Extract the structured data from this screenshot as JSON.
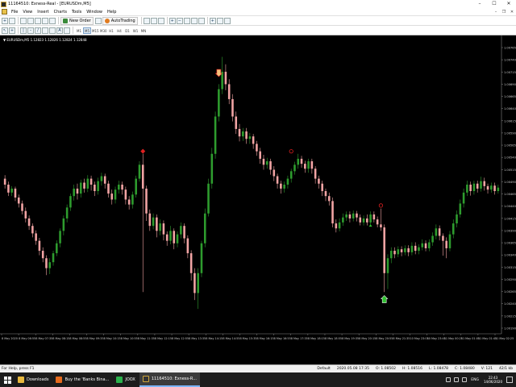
{
  "window": {
    "title": "11164510: Exness-Real - [EURUSDm,M5]",
    "min_label": "–",
    "max_label": "☐",
    "close_label": "✕"
  },
  "menu": {
    "items": [
      "File",
      "View",
      "Insert",
      "Charts",
      "Tools",
      "Window",
      "Help"
    ],
    "mdi_min": "–",
    "mdi_restore": "❐",
    "mdi_close": "✕"
  },
  "toolbar": {
    "new_order_label": "New Order",
    "autotrading_label": "AutoTrading"
  },
  "timeframes": [
    "M1",
    "M5",
    "M15",
    "M30",
    "H1",
    "H4",
    "D1",
    "W1",
    "MN"
  ],
  "active_timeframe": "M5",
  "chart": {
    "symbol_line": "▼ EURUSDm,M5  1.12823  1.12826  1.12824  1.12848",
    "colors": {
      "bull": "#2e9c2e",
      "bear": "#f2a4a4",
      "background": "#000000",
      "axis_text": "#cccccc"
    }
  },
  "chart_data": {
    "type": "candlestick",
    "symbol": "EURUSDm",
    "timeframe": "M5",
    "price_labels": [
      "1.00765",
      "1.00740",
      "1.00715",
      "1.00690",
      "1.00665",
      "1.00640",
      "1.00615",
      "1.00590",
      "1.00565",
      "1.00540",
      "1.00515",
      "1.00490",
      "1.00465",
      "1.00440",
      "1.00415",
      "1.00390",
      "1.00365",
      "1.00340",
      "1.00315",
      "1.00290",
      "1.00265",
      "1.00240",
      "1.00215",
      "1.00190"
    ],
    "time_labels": [
      "8 May 2020",
      "8 May 06:55",
      "8 May 07:35",
      "8 May 08:15",
      "8 May 08:55",
      "8 May 09:35",
      "8 May 10:15",
      "8 May 10:55",
      "8 May 11:35",
      "8 May 12:15",
      "8 May 12:55",
      "8 May 13:35",
      "8 May 14:15",
      "8 May 14:55",
      "8 May 15:35",
      "8 May 16:15",
      "8 May 16:55",
      "8 May 17:35",
      "8 May 18:15",
      "8 May 18:55",
      "8 May 19:35",
      "8 May 20:15",
      "8 May 20:55",
      "8 May 21:35",
      "10 May 23:05",
      "10 May 23:45",
      "11 May 00:25",
      "11 May 01:05",
      "11 May 01:45",
      "11 May 02:25"
    ],
    "candles": [
      [
        1.0049,
        1.00478,
        1.00497,
        1.0047
      ],
      [
        1.00478,
        1.00462,
        1.00484,
        1.00455
      ],
      [
        1.00462,
        1.0047,
        1.00475,
        1.00455
      ],
      [
        1.0047,
        1.00452,
        1.00474,
        1.00445
      ],
      [
        1.00452,
        1.0044,
        1.00458,
        1.00432
      ],
      [
        1.0044,
        1.00425,
        1.00446,
        1.00418
      ],
      [
        1.00425,
        1.0041,
        1.00432,
        1.00402
      ],
      [
        1.0041,
        1.00395,
        1.00416,
        1.00387
      ],
      [
        1.00395,
        1.0038,
        1.004,
        1.00372
      ],
      [
        1.0038,
        1.00365,
        1.00386,
        1.00357
      ],
      [
        1.00365,
        1.00345,
        1.00371,
        1.00336
      ],
      [
        1.00345,
        1.0033,
        1.00352,
        1.00322
      ],
      [
        1.0033,
        1.0031,
        1.00336,
        1.00296
      ],
      [
        1.0031,
        1.00322,
        1.0033,
        1.00298
      ],
      [
        1.00322,
        1.0034,
        1.00345,
        1.00315
      ],
      [
        1.0034,
        1.0036,
        1.00366,
        1.00334
      ],
      [
        1.0036,
        1.00385,
        1.0039,
        1.00352
      ],
      [
        1.00385,
        1.0041,
        1.00416,
        1.00376
      ],
      [
        1.0041,
        1.00432,
        1.00438,
        1.00402
      ],
      [
        1.00432,
        1.00455,
        1.0046,
        1.00425
      ],
      [
        1.00455,
        1.0047,
        1.00478,
        1.00446
      ],
      [
        1.0047,
        1.0046,
        1.0048,
        1.00448
      ],
      [
        1.0046,
        1.00482,
        1.00488,
        1.00452
      ],
      [
        1.00482,
        1.0047,
        1.0049,
        1.00462
      ],
      [
        1.0047,
        1.0049,
        1.00497,
        1.00463
      ],
      [
        1.0049,
        1.00478,
        1.00496,
        1.00466
      ],
      [
        1.00478,
        1.00465,
        1.00484,
        1.00455
      ],
      [
        1.00465,
        1.00485,
        1.00492,
        1.00458
      ],
      [
        1.00485,
        1.00495,
        1.00502,
        1.00476
      ],
      [
        1.00495,
        1.0048,
        1.005,
        1.0047
      ],
      [
        1.0048,
        1.0046,
        1.00486,
        1.00452
      ],
      [
        1.0046,
        1.00448,
        1.00468,
        1.00438
      ],
      [
        1.00448,
        1.00468,
        1.00474,
        1.0044
      ],
      [
        1.00468,
        1.00478,
        1.00486,
        1.0046
      ],
      [
        1.00478,
        1.00468,
        1.00484,
        1.00458
      ],
      [
        1.00468,
        1.00448,
        1.00474,
        1.00438
      ],
      [
        1.00448,
        1.00438,
        1.00455,
        1.00428
      ],
      [
        1.00438,
        1.00458,
        1.00464,
        1.0043
      ],
      [
        1.00458,
        1.0049,
        1.00496,
        1.00452
      ],
      [
        1.0049,
        1.00518,
        1.00525,
        1.00484
      ],
      [
        1.00518,
        1.0047,
        1.0054,
        1.00262
      ],
      [
        1.0047,
        1.0042,
        1.00476,
        1.00405
      ],
      [
        1.0042,
        1.00395,
        1.00428,
        1.00385
      ],
      [
        1.00395,
        1.00412,
        1.0042,
        1.00388
      ],
      [
        1.00412,
        1.00385,
        1.00418,
        1.00372
      ],
      [
        1.00385,
        1.004,
        1.00408,
        1.00376
      ],
      [
        1.004,
        1.00378,
        1.00406,
        1.00366
      ],
      [
        1.00378,
        1.00365,
        1.00384,
        1.00355
      ],
      [
        1.00365,
        1.00385,
        1.00395,
        1.00358
      ],
      [
        1.00385,
        1.0036,
        1.0039,
        1.00348
      ],
      [
        1.0036,
        1.00378,
        1.00384,
        1.00352
      ],
      [
        1.00378,
        1.00395,
        1.00402,
        1.0037
      ],
      [
        1.00395,
        1.0037,
        1.004,
        1.0036
      ],
      [
        1.0037,
        1.0034,
        1.00376,
        1.0033
      ],
      [
        1.0034,
        1.003,
        1.00346,
        1.00285
      ],
      [
        1.003,
        1.0026,
        1.0031,
        1.00246
      ],
      [
        1.0026,
        1.003,
        1.0031,
        1.00228
      ],
      [
        1.003,
        1.0036,
        1.00365,
        1.00292
      ],
      [
        1.0036,
        1.0042,
        1.0043,
        1.00352
      ],
      [
        1.0042,
        1.0048,
        1.0049,
        1.00414
      ],
      [
        1.0048,
        1.0054,
        1.00552,
        1.0047
      ],
      [
        1.0054,
        1.00615,
        1.00625,
        1.0053
      ],
      [
        1.00615,
        1.0067,
        1.0068,
        1.00605
      ],
      [
        1.0067,
        1.00705,
        1.00735,
        1.0066
      ],
      [
        1.00705,
        1.0068,
        1.0072,
        1.00668
      ],
      [
        1.0068,
        1.0065,
        1.0069,
        1.0064
      ],
      [
        1.0065,
        1.00615,
        1.0066,
        1.00605
      ],
      [
        1.00615,
        1.0059,
        1.00625,
        1.0058
      ],
      [
        1.0059,
        1.00575,
        1.006,
        1.00565
      ],
      [
        1.00575,
        1.00585,
        1.00592,
        1.00566
      ],
      [
        1.00585,
        1.0057,
        1.00592,
        1.0056
      ],
      [
        1.0057,
        1.00575,
        1.00582,
        1.0056
      ],
      [
        1.00575,
        1.0056,
        1.0058,
        1.0055
      ],
      [
        1.0056,
        1.00545,
        1.00566,
        1.00536
      ],
      [
        1.00545,
        1.0053,
        1.00552,
        1.0052
      ],
      [
        1.0053,
        1.00518,
        1.00538,
        1.00508
      ],
      [
        1.00518,
        1.00525,
        1.00532,
        1.0051
      ],
      [
        1.00525,
        1.00508,
        1.0053,
        1.00498
      ],
      [
        1.00508,
        1.00495,
        1.00515,
        1.00485
      ],
      [
        1.00495,
        1.0048,
        1.005,
        1.0047
      ],
      [
        1.0048,
        1.0047,
        1.00486,
        1.0046
      ],
      [
        1.0047,
        1.00478,
        1.00484,
        1.00462
      ],
      [
        1.00478,
        1.0049,
        1.00496,
        1.0047
      ],
      [
        1.0049,
        1.00505,
        1.0051,
        1.00482
      ],
      [
        1.00505,
        1.00518,
        1.00524,
        1.00498
      ],
      [
        1.00518,
        1.0053,
        1.0054,
        1.0051
      ],
      [
        1.0053,
        1.0052,
        1.00536,
        1.00512
      ],
      [
        1.0052,
        1.0051,
        1.00526,
        1.00502
      ],
      [
        1.0051,
        1.00525,
        1.0053,
        1.00502
      ],
      [
        1.00525,
        1.0051,
        1.0053,
        1.005
      ],
      [
        1.0051,
        1.0049,
        1.00515,
        1.0048
      ],
      [
        1.0049,
        1.0048,
        1.00496,
        1.0047
      ],
      [
        1.0048,
        1.00465,
        1.00486,
        1.00455
      ],
      [
        1.00465,
        1.00455,
        1.0047,
        1.00445
      ],
      [
        1.00455,
        1.00445,
        1.00462,
        1.00436
      ],
      [
        1.00445,
        1.004,
        1.00452,
        1.00392
      ],
      [
        1.004,
        1.0039,
        1.00408,
        1.00382
      ],
      [
        1.0039,
        1.00402,
        1.0041,
        1.00384
      ],
      [
        1.00402,
        1.00412,
        1.0042,
        1.00395
      ],
      [
        1.00412,
        1.00418,
        1.00424,
        1.00405
      ],
      [
        1.00418,
        1.0041,
        1.00424,
        1.00402
      ],
      [
        1.0041,
        1.0042,
        1.00426,
        1.00404
      ],
      [
        1.0042,
        1.00412,
        1.00425,
        1.00404
      ],
      [
        1.00412,
        1.00402,
        1.00418,
        1.00396
      ],
      [
        1.00402,
        1.0041,
        1.00416,
        1.00396
      ],
      [
        1.0041,
        1.00402,
        1.00418,
        1.00396
      ],
      [
        1.00402,
        1.00418,
        1.00424,
        1.00398
      ],
      [
        1.00418,
        1.00408,
        1.00424,
        1.00402
      ],
      [
        1.00408,
        1.00398,
        1.00414,
        1.00392
      ],
      [
        1.00398,
        1.00392,
        1.0043,
        1.00385
      ],
      [
        1.00392,
        1.003,
        1.00398,
        1.00262
      ],
      [
        1.003,
        1.0033,
        1.00338,
        1.00268
      ],
      [
        1.0033,
        1.00345,
        1.00352,
        1.0032
      ],
      [
        1.00345,
        1.00338,
        1.00352,
        1.0033
      ],
      [
        1.00338,
        1.00348,
        1.00354,
        1.00332
      ],
      [
        1.00348,
        1.00342,
        1.00354,
        1.00334
      ],
      [
        1.00342,
        1.0035,
        1.00356,
        1.00336
      ],
      [
        1.0035,
        1.00342,
        1.00356,
        1.00334
      ],
      [
        1.00342,
        1.00355,
        1.00362,
        1.00336
      ],
      [
        1.00355,
        1.00345,
        1.00362,
        1.00338
      ],
      [
        1.00345,
        1.00352,
        1.00358,
        1.00338
      ],
      [
        1.00352,
        1.0036,
        1.00368,
        1.00346
      ],
      [
        1.0036,
        1.0035,
        1.00366,
        1.00344
      ],
      [
        1.0035,
        1.00362,
        1.00368,
        1.00344
      ],
      [
        1.00362,
        1.00375,
        1.00382,
        1.00355
      ],
      [
        1.00375,
        1.0039,
        1.00398,
        1.00368
      ],
      [
        1.0039,
        1.00375,
        1.00396,
        1.00366
      ],
      [
        1.00375,
        1.00365,
        1.0038,
        1.00335
      ],
      [
        1.00365,
        1.0035,
        1.00372,
        1.0033
      ],
      [
        1.0035,
        1.00378,
        1.00385,
        1.00344
      ],
      [
        1.00378,
        1.004,
        1.00408,
        1.0037
      ],
      [
        1.004,
        1.00418,
        1.00426,
        1.00392
      ],
      [
        1.00418,
        1.0044,
        1.00448,
        1.00412
      ],
      [
        1.0044,
        1.00462,
        1.0047,
        1.00432
      ],
      [
        1.00462,
        1.00478,
        1.00486,
        1.00455
      ],
      [
        1.00478,
        1.00465,
        1.00484,
        1.00456
      ],
      [
        1.00465,
        1.0048,
        1.00486,
        1.00458
      ],
      [
        1.0048,
        1.0047,
        1.00486,
        1.00462
      ],
      [
        1.0047,
        1.00485,
        1.00494,
        1.00464
      ],
      [
        1.00485,
        1.00475,
        1.00492,
        1.00466
      ],
      [
        1.00475,
        1.00468,
        1.0048,
        1.0046
      ],
      [
        1.00468,
        1.00476,
        1.00482,
        1.00462
      ],
      [
        1.00476,
        1.00465,
        1.00482,
        1.00458
      ],
      [
        1.00465,
        1.00472,
        1.00478,
        1.0046
      ]
    ],
    "signals": [
      {
        "candle": 40,
        "type": "diamond",
        "price": 1.00545
      },
      {
        "candle": 62,
        "type": "down-arrow",
        "price": 1.007
      },
      {
        "candle": 83,
        "type": "circle",
        "price": 1.00545
      },
      {
        "candle": 106,
        "type": "up-dot",
        "price": 1.00395
      },
      {
        "candle": 109,
        "type": "circle",
        "price": 1.00436
      },
      {
        "candle": 110,
        "type": "up-arrow",
        "price": 1.0025
      }
    ]
  },
  "status": {
    "help": "For Help, press F1",
    "profile": "Default",
    "datetime": "2020.05.08 17:35",
    "open": "O: 1.08502",
    "high": "H: 1.08516",
    "low": "L: 1.08478",
    "close": "C: 1.08480",
    "volume": "V: 121",
    "traffic": "42/1 kb"
  },
  "taskbar": {
    "items": [
      {
        "label": "Downloads",
        "icon": "folder-icon"
      },
      {
        "label": "Buy the 'Banks Bina...",
        "icon": "firefox-icon"
      },
      {
        "label": "JOOX",
        "icon": "joox-icon"
      },
      {
        "label": "11164510: Exness-R...",
        "icon": "metatrader-icon"
      }
    ],
    "active_index": 3,
    "lang": "ENG",
    "time": "22:43",
    "date": "14/06/2020"
  }
}
